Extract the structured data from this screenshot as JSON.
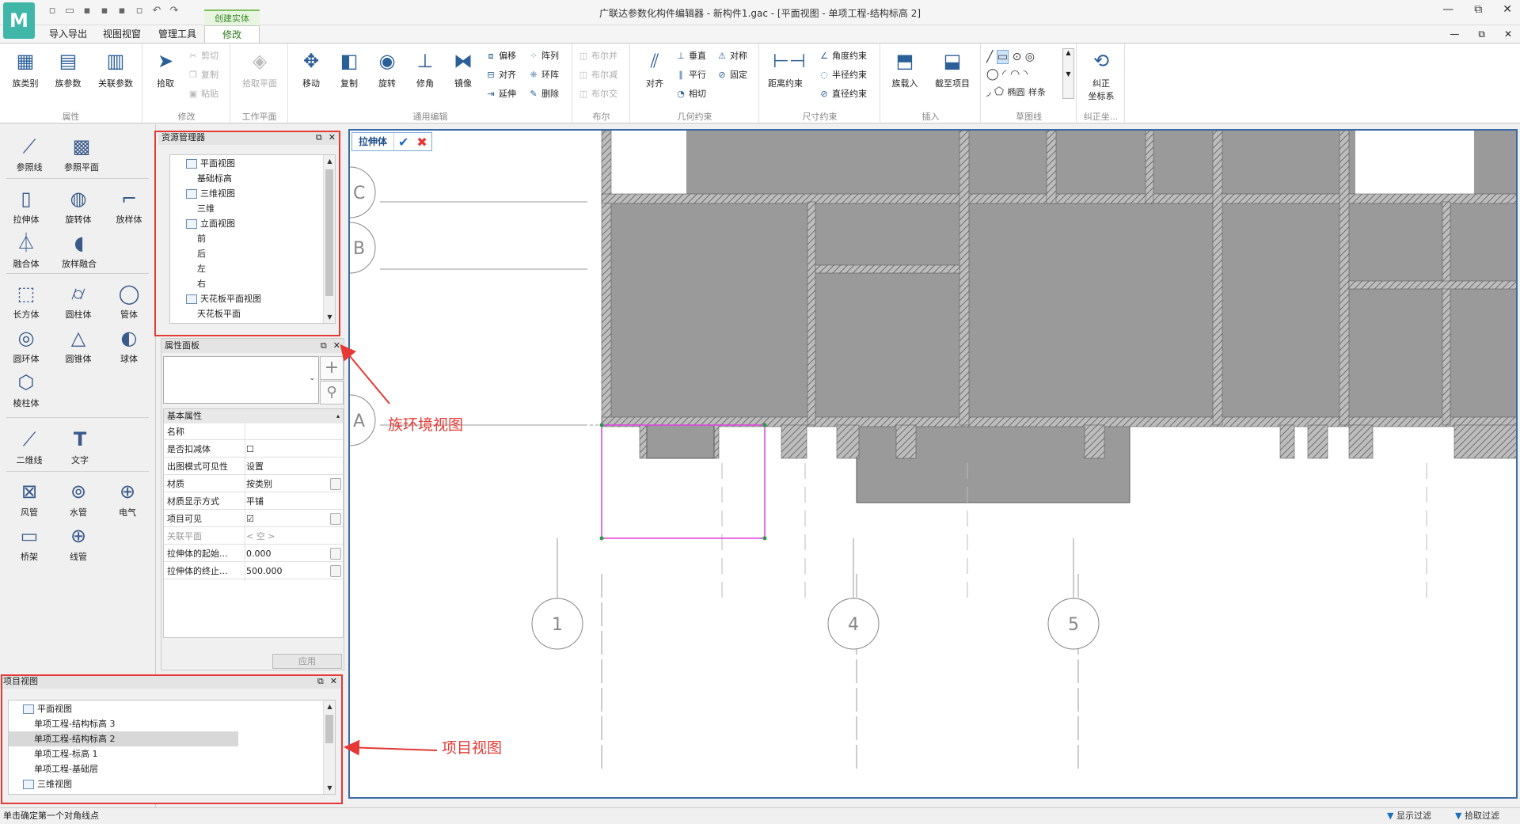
{
  "window": {
    "title": "广联达参数化构件编辑器 - 新构件1.gac - [平面视图 - 单项工程-结构标高 2]",
    "min": "—",
    "restore": "⧉",
    "close": "✕"
  },
  "tabs": {
    "import_export": "导入导出",
    "view_window": "视图视窗",
    "manage_tools": "管理工具",
    "context_group": "创建实体",
    "modify": "修改"
  },
  "ribbon": {
    "groups": {
      "properties": "属性",
      "modify": "修改",
      "work_plane": "工作平面",
      "general_edit": "通用编辑",
      "boolean": "布尔",
      "geo_constraint": "几何约束",
      "dim_constraint": "尺寸约束",
      "insert": "插入",
      "sketch": "草图线",
      "correct": "纠正坐..."
    },
    "family_type": "族类别",
    "family_params": "族参数",
    "related_params": "关联参数",
    "pick": "拾取",
    "cut": "剪切",
    "copy_small": "复制",
    "paste": "粘贴",
    "pick_plane": "拾取平面",
    "move": "移动",
    "copy": "复制",
    "rotate": "旋转",
    "fillet": "修角",
    "mirror": "镜像",
    "offset": "偏移",
    "align_small": "对齐",
    "extend": "延伸",
    "array": "阵列",
    "ring_array": "环阵",
    "delete": "删除",
    "bool_union": "布尔并",
    "bool_subtract": "布尔减",
    "bool_intersect": "布尔交",
    "align": "对齐",
    "vertical": "垂直",
    "parallel": "平行",
    "tangent": "相切",
    "symmetric": "对称",
    "fixed": "固定",
    "distance_constraint": "距离约束",
    "angle_constraint": "角度约束",
    "radius_constraint": "半径约束",
    "diameter_constraint": "直径约束",
    "load_family": "族载入",
    "cut_to_project": "截至项目",
    "sketch_ellipse": "椭圆",
    "sketch_spline": "样条",
    "correct_coords_1": "纠正",
    "correct_coords_2": "坐标系"
  },
  "palette": {
    "ref_line": "参照线",
    "ref_plane": "参照平面",
    "extrusion": "拉伸体",
    "revolve": "旋转体",
    "sweep": "放样体",
    "blend": "融合体",
    "swept_blend": "放样融合",
    "box": "长方体",
    "cylinder": "圆柱体",
    "pipe": "管体",
    "torus": "圆环体",
    "cone": "圆锥体",
    "sphere": "球体",
    "prism": "棱柱体",
    "line2d": "二维线",
    "text": "文字",
    "duct": "风管",
    "water_pipe": "水管",
    "electric": "电气",
    "cable_tray": "桥架",
    "conduit": "线管"
  },
  "resource_manager": {
    "title": "资源管理器",
    "items": [
      {
        "label": "平面视图",
        "level": 1,
        "icon": true
      },
      {
        "label": "基础标高",
        "level": 2
      },
      {
        "label": "三维视图",
        "level": 1,
        "icon": true
      },
      {
        "label": "三维",
        "level": 2
      },
      {
        "label": "立面视图",
        "level": 1,
        "icon": true
      },
      {
        "label": "前",
        "level": 2
      },
      {
        "label": "后",
        "level": 2
      },
      {
        "label": "左",
        "level": 2
      },
      {
        "label": "右",
        "level": 2
      },
      {
        "label": "天花板平面视图",
        "level": 1,
        "icon": true
      },
      {
        "label": "天花板平面",
        "level": 2
      }
    ]
  },
  "property_panel": {
    "title": "属性面板",
    "section": "基本属性",
    "rows": [
      {
        "key": "名称",
        "value": "",
        "button": false
      },
      {
        "key": "是否扣减体",
        "value": "☐",
        "button": false
      },
      {
        "key": "出图模式可见性",
        "value": "设置",
        "button": false
      },
      {
        "key": "材质",
        "value": "按类别",
        "button": true
      },
      {
        "key": "材质显示方式",
        "value": "平铺",
        "button": false
      },
      {
        "key": "项目可见",
        "value": "☑",
        "button": true
      },
      {
        "key": "关联平面",
        "value": "< 空 >",
        "button": false
      },
      {
        "key": "拉伸体的起始...",
        "value": "0.000",
        "button": true
      },
      {
        "key": "拉伸体的终止...",
        "value": "500.000",
        "button": true
      }
    ],
    "apply": "应用"
  },
  "project_view": {
    "title": "项目视图",
    "items": [
      {
        "label": "平面视图",
        "level": 1,
        "icon": true,
        "selected": false
      },
      {
        "label": "单项工程-结构标高 3",
        "level": 2,
        "selected": false
      },
      {
        "label": "单项工程-结构标高 2",
        "level": 2,
        "selected": true
      },
      {
        "label": "单项工程-标高 1",
        "level": 2,
        "selected": false
      },
      {
        "label": "单项工程-基础层",
        "level": 2,
        "selected": false
      },
      {
        "label": "三维视图",
        "level": 1,
        "icon": true,
        "selected": false
      }
    ]
  },
  "canvas": {
    "mode_label": "拉伸体",
    "confirm": "✔",
    "cancel": "✖",
    "grid_rows": [
      "C",
      "B",
      "A"
    ],
    "grid_cols": [
      "1",
      "4",
      "5"
    ]
  },
  "annotations": {
    "family_env_view": "族环境视图",
    "project_view": "项目视图"
  },
  "status": {
    "prompt": "单击确定第一个对角线点",
    "display_filter": "显示过滤",
    "pick_filter": "拾取过滤"
  },
  "colors": {
    "accent": "#2a5f98",
    "annotation_red": "#e53935",
    "sketch_magenta": "#e040e0",
    "wall_gray": "#8c8c8c"
  }
}
